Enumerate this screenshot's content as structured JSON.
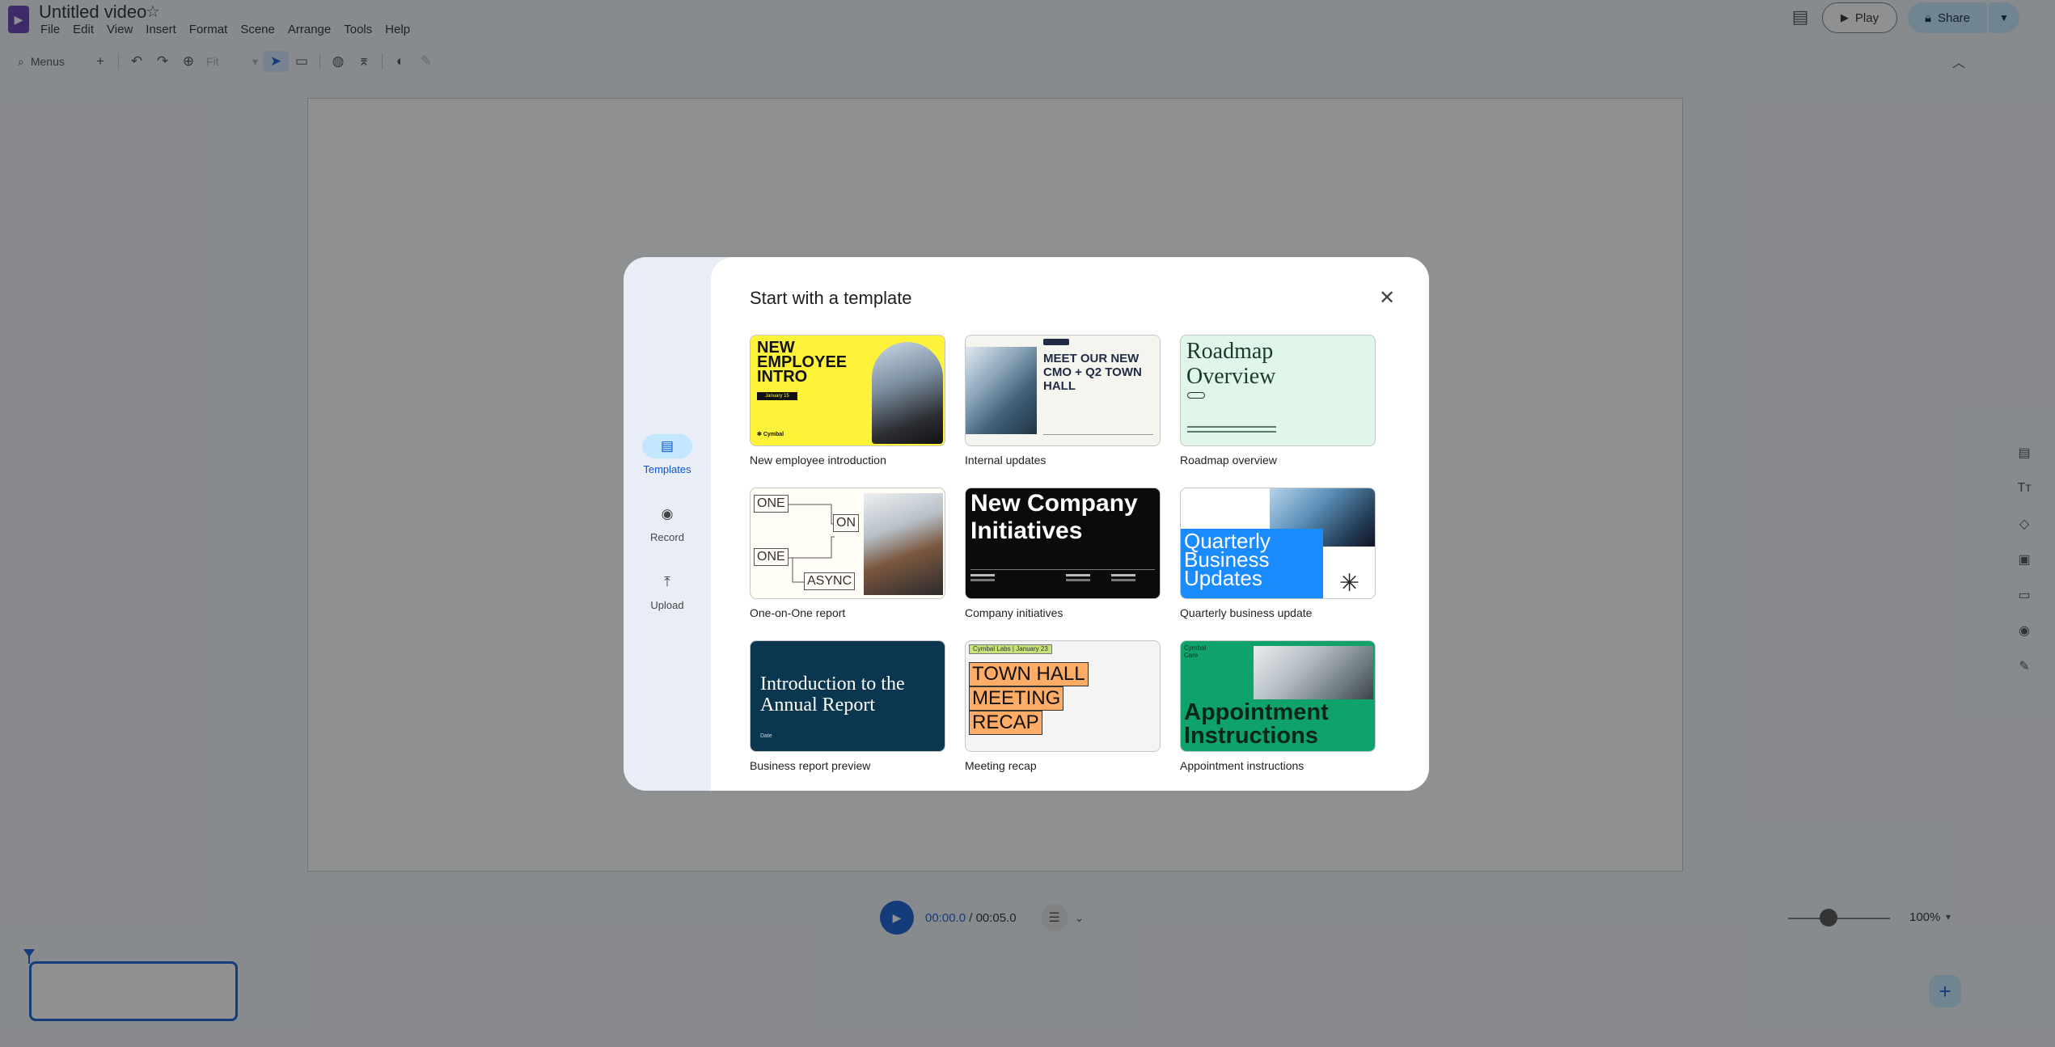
{
  "header": {
    "doc_title": "Untitled video",
    "menu": [
      "File",
      "Edit",
      "View",
      "Insert",
      "Format",
      "Scene",
      "Arrange",
      "Tools",
      "Help"
    ],
    "play_label": "Play",
    "share_label": "Share"
  },
  "toolbar": {
    "menus_label": "Menus",
    "fit_label": "Fit"
  },
  "playback": {
    "current_time": "00:00.0",
    "separator": " / ",
    "total_time": "00:05.0",
    "zoom": "100%",
    "zoom_level_percent": 40
  },
  "dialog": {
    "title": "Start with a template",
    "nav": [
      {
        "label": "Templates",
        "icon": "templates-icon",
        "active": true
      },
      {
        "label": "Record",
        "icon": "record-icon",
        "active": false
      },
      {
        "label": "Upload",
        "icon": "upload-icon",
        "active": false
      }
    ],
    "templates": [
      {
        "label": "New employee introduction",
        "thumb": {
          "title": "NEW EMPLOYEE INTRO",
          "tag": "January 15",
          "brand": "Cymbal"
        }
      },
      {
        "label": "Internal updates",
        "thumb": {
          "title": "MEET OUR NEW CMO + Q2 TOWN HALL"
        }
      },
      {
        "label": "Roadmap overview",
        "thumb": {
          "title": "Roadmap Overview"
        }
      },
      {
        "label": "One-on-One report",
        "thumb": {
          "boxes": [
            "ONE",
            "ON",
            "ONE",
            "ASYNC"
          ]
        }
      },
      {
        "label": "Company initiatives",
        "thumb": {
          "title": "New Company Initiatives"
        }
      },
      {
        "label": "Quarterly business update",
        "thumb": {
          "title": "Quarterly Business Updates"
        }
      },
      {
        "label": "Business report preview",
        "thumb": {
          "title": "Introduction to the Annual Report",
          "date": "Date"
        }
      },
      {
        "label": "Meeting recap",
        "thumb": {
          "chip": "Cymbal Labs | January 23",
          "lines": [
            "TOWN HALL",
            "MEETING",
            "RECAP"
          ]
        }
      },
      {
        "label": "Appointment instructions",
        "thumb": {
          "brand": "Cymbal Care",
          "title": "Appointment Instructions"
        }
      }
    ]
  },
  "colors": {
    "accent": "#0b57d0",
    "share_bg": "#c2e7ff",
    "logo": "#5e35b1"
  }
}
